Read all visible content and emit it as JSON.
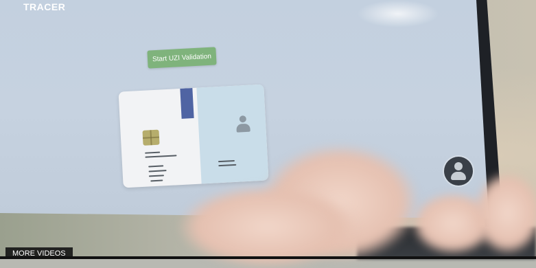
{
  "brand": {
    "text": "TRACER"
  },
  "start_button": {
    "label": "Start UZI Validation"
  },
  "id_card": {
    "stripe_color": "#4f64a3",
    "chip_color": "#b6ad6c"
  },
  "avatar": {
    "icon": "user-icon"
  },
  "overlay": {
    "more_videos_label": "MORE VIDEOS"
  },
  "colors": {
    "button_green": "#7fb37c",
    "screen_blue": "#c4d0de"
  }
}
